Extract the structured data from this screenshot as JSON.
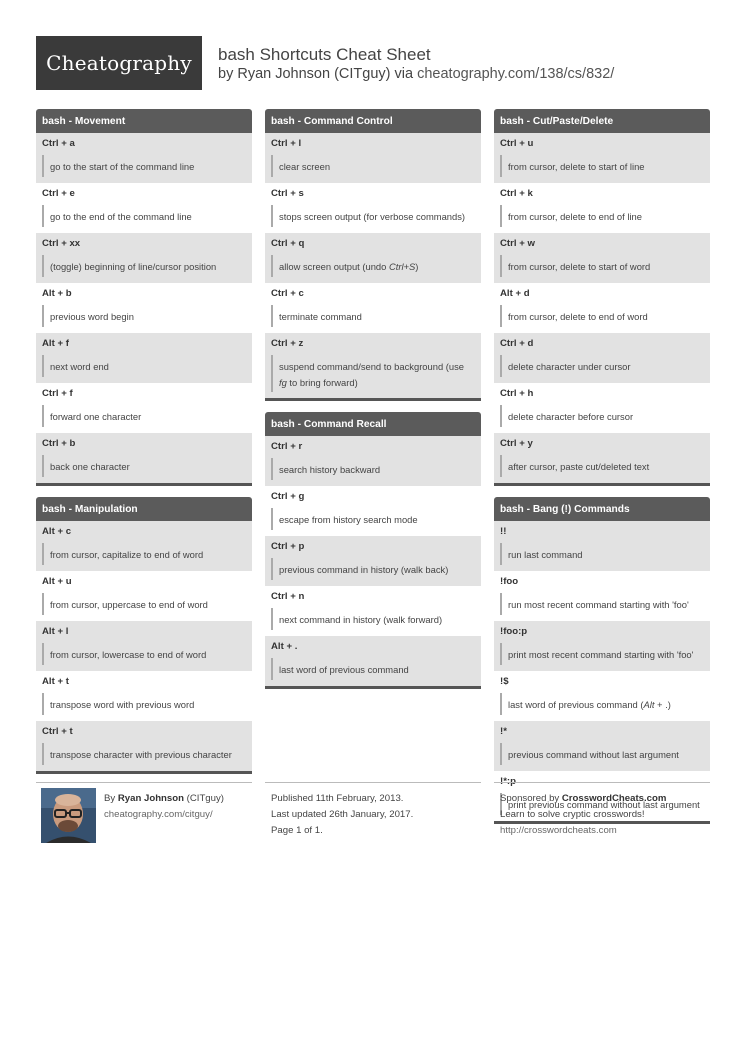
{
  "header": {
    "logo": "Cheatography",
    "title": "bash Shortcuts Cheat Sheet",
    "by": "by",
    "author": "Ryan Johnson (CITguy)",
    "via": "via",
    "url": "cheatography.com/138/cs/832/"
  },
  "sections": {
    "movement": {
      "title": "bash - Movement",
      "rows": [
        {
          "key": "Ctrl + a",
          "desc": "go to the start of the command line"
        },
        {
          "key": "Ctrl + e",
          "desc": "go to the end of the command line"
        },
        {
          "key": "Ctrl + xx",
          "desc": "(toggle) beginning of line/cursor position"
        },
        {
          "key": "Alt + b",
          "desc": "previous word begin"
        },
        {
          "key": "Alt + f",
          "desc": "next word end"
        },
        {
          "key": "Ctrl + f",
          "desc": "forward one character"
        },
        {
          "key": "Ctrl + b",
          "desc": "back one character"
        }
      ]
    },
    "manipulation": {
      "title": "bash - Manipulation",
      "rows": [
        {
          "key": "Alt + c",
          "desc": "from cursor, capitalize to end of word"
        },
        {
          "key": "Alt + u",
          "desc": "from cursor, uppercase to end of word"
        },
        {
          "key": "Alt + l",
          "desc": "from cursor, lowercase to end of word"
        },
        {
          "key": "Alt + t",
          "desc": "transpose word with previous word"
        },
        {
          "key": "Ctrl + t",
          "desc": "transpose character with previous character"
        }
      ]
    },
    "command_control": {
      "title": "bash - Command Control",
      "rows": [
        {
          "key": "Ctrl + l",
          "desc": "clear screen"
        },
        {
          "key": "Ctrl + s",
          "desc": "stops screen output (for verbose commands)"
        },
        {
          "key": "Ctrl + q",
          "desc_pre": "allow screen output (undo ",
          "desc_em": "Ctrl+S",
          "desc_post": ")"
        },
        {
          "key": "Ctrl + c",
          "desc": "terminate command"
        },
        {
          "key": "Ctrl + z",
          "desc_pre": "suspend command/send to background (use ",
          "desc_em": "fg",
          "desc_post": " to bring forward)"
        }
      ]
    },
    "command_recall": {
      "title": "bash - Command Recall",
      "rows": [
        {
          "key": "Ctrl + r",
          "desc": "search history backward"
        },
        {
          "key": "Ctrl + g",
          "desc": "escape from history search mode"
        },
        {
          "key": "Ctrl + p",
          "desc": "previous command in history (walk back)"
        },
        {
          "key": "Ctrl + n",
          "desc": "next command in history (walk forward)"
        },
        {
          "key": "Alt + .",
          "desc": "last word of previous command"
        }
      ]
    },
    "cut_paste_delete": {
      "title": "bash - Cut/Paste/Delete",
      "rows": [
        {
          "key": "Ctrl + u",
          "desc": "from cursor, delete to start of line"
        },
        {
          "key": "Ctrl + k",
          "desc": "from cursor, delete to end of line"
        },
        {
          "key": "Ctrl + w",
          "desc": "from cursor, delete to start of word"
        },
        {
          "key": "Alt + d",
          "desc": "from cursor, delete to end of word"
        },
        {
          "key": "Ctrl + d",
          "desc": "delete character under cursor"
        },
        {
          "key": "Ctrl + h",
          "desc": "delete character before cursor"
        },
        {
          "key": "Ctrl + y",
          "desc": "after cursor, paste cut/deleted text"
        }
      ]
    },
    "bang_commands": {
      "title": "bash - Bang (!) Commands",
      "rows": [
        {
          "key": "!!",
          "desc": "run last command"
        },
        {
          "key": "!foo",
          "desc": "run most recent command starting with 'foo'"
        },
        {
          "key": "!foo:p",
          "desc": "print most recent command starting with 'foo'"
        },
        {
          "key": "!$",
          "desc_pre": "last word of previous command (",
          "desc_em": "Alt",
          "desc_post": " + .)"
        },
        {
          "key": "!*",
          "desc": "previous command without last argument"
        },
        {
          "key": "!*:p",
          "desc": "print previous command without last argument"
        }
      ]
    }
  },
  "footer": {
    "author_prefix": "By",
    "author_name": "Ryan Johnson",
    "author_handle": "(CITguy)",
    "author_link": "cheatography.com/citguy/",
    "published": "Published 11th February, 2013.",
    "updated": "Last updated 26th January, 2017.",
    "page": "Page 1 of 1.",
    "sponsor_prefix": "Sponsored by",
    "sponsor_name": "CrosswordCheats.com",
    "sponsor_tagline": "Learn to solve cryptic crosswords!",
    "sponsor_link": "http://crosswordcheats.com"
  },
  "colors": {
    "section_header_bg": "#5b5b5b",
    "logo_bg": "#3a3a3a",
    "row_alt_bg": "#e2e2e2"
  }
}
